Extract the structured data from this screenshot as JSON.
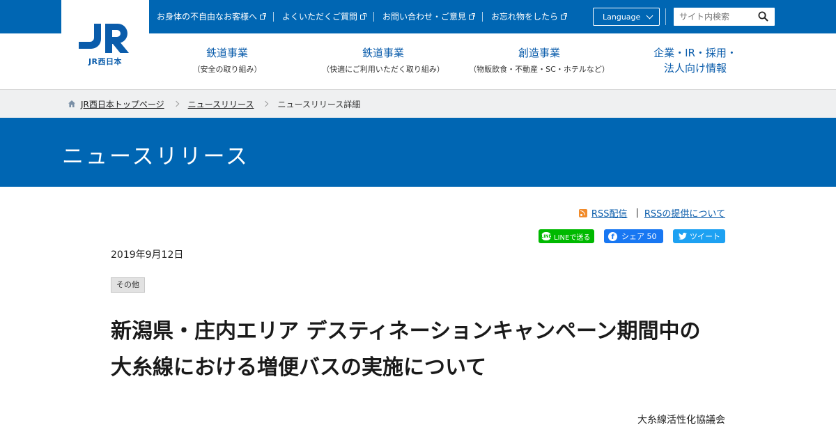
{
  "header": {
    "logo_text": "JR",
    "logo_sub": "JR西日本",
    "util_links": [
      {
        "label": "お身体の不自由なお客様へ"
      },
      {
        "label": "よくいただくご質問"
      },
      {
        "label": "お問い合わせ・ご意見"
      },
      {
        "label": "お忘れ物をしたら"
      }
    ],
    "language_label": "Language",
    "search_placeholder": "サイト内検索"
  },
  "gnav": [
    {
      "main": "鉄道事業",
      "sub": "（安全の取り組み）"
    },
    {
      "main": "鉄道事業",
      "sub": "（快適にご利用いただく取り組み）"
    },
    {
      "main": "創造事業",
      "sub": "（物販飲食・不動産・SC・ホテルなど）"
    },
    {
      "main": "企業・IR・採用・\n法人向け情報",
      "sub": ""
    }
  ],
  "breadcrumb": {
    "items": [
      "JR西日本トップページ",
      "ニュースリリース"
    ],
    "current": "ニュースリリース詳細"
  },
  "banner_title": "ニュースリリース",
  "rss": {
    "feed_label": "RSS配信",
    "about_label": "RSSの提供について"
  },
  "share": {
    "line_label": "LINEで送る",
    "fb_label": "シェア 50",
    "tw_label": "ツイート"
  },
  "article": {
    "date": "2019年9月12日",
    "category": "その他",
    "title_line1": "新潟県・庄内エリア デスティネーションキャンペーン期間中の",
    "title_line2": "大糸線における増便バスの実施について",
    "organization": "大糸線活性化協議会"
  },
  "colors": {
    "brand_blue": "#0066b3",
    "link_blue": "#0a5cab",
    "breadcrumb_bg": "#eff0f1",
    "line_green": "#00b900",
    "facebook_blue": "#1877f2",
    "twitter_blue": "#1da1f2",
    "rss_orange": "#f18b2b"
  }
}
